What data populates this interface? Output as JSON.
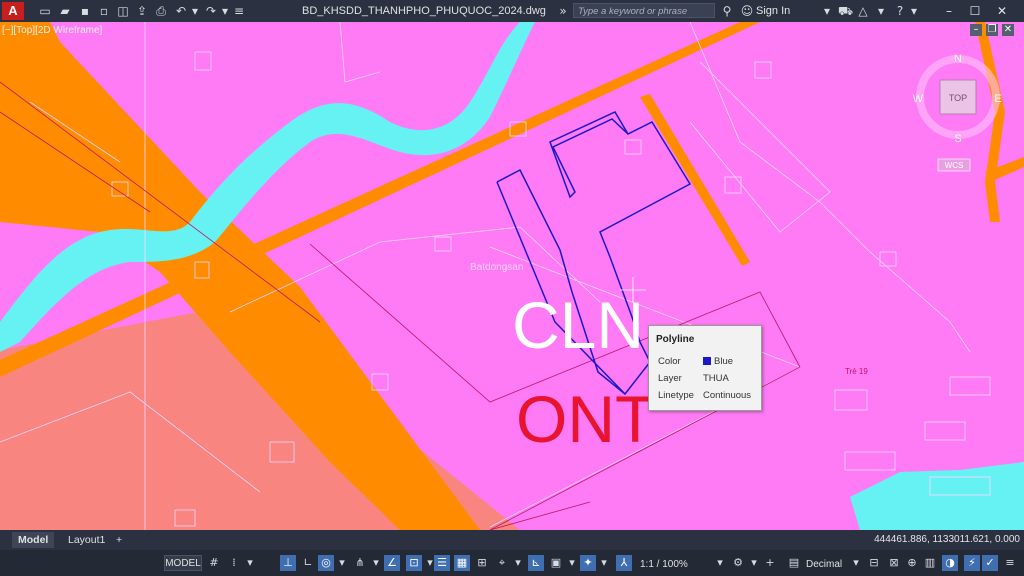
{
  "titlebar": {
    "app_logo": "A",
    "document_title": "BD_KHSDD_THANHPHO_PHUQUOC_2024.dwg",
    "search_placeholder": "Type a keyword or phrase",
    "sign_in": "Sign In",
    "icons": [
      "new-icon",
      "open-icon",
      "save-icon",
      "save-as-icon",
      "open-web-icon",
      "save-web-icon",
      "print-icon",
      "undo-icon",
      "redo-icon",
      "customize-icon",
      "search-icon",
      "binoculars-icon",
      "user-icon",
      "cart-icon",
      "share-icon",
      "help-icon",
      "minimize-icon",
      "maximize-icon",
      "close-icon"
    ]
  },
  "viewport": {
    "label": "[−][Top][2D Wireframe]",
    "viewcube": {
      "top": "TOP",
      "north": "N",
      "south": "S",
      "east": "E",
      "west": "W",
      "wcs": "WCS"
    },
    "zone_labels": {
      "primary": "CLN",
      "secondary": "ONT",
      "small": "Trẻ  19"
    },
    "watermark": "Batdongsan",
    "colors": {
      "land_pink": "#ff7bf5",
      "road_orange": "#ff8c00",
      "water_cyan": "#66f2f2",
      "salmon": "#f8857f",
      "polyline_blue": "#1a1ac8"
    }
  },
  "tooltip": {
    "title": "Polyline",
    "rows": [
      {
        "key": "Color",
        "value": "Blue"
      },
      {
        "key": "Layer",
        "value": "THUA"
      },
      {
        "key": "Linetype",
        "value": "Continuous"
      }
    ]
  },
  "tabs": [
    {
      "label": "Model",
      "active": true
    },
    {
      "label": "Layout1",
      "active": false
    }
  ],
  "add_tab": "+",
  "coordinates": "444461.886, 1133011.621, 0.000",
  "statusbar": {
    "model_label": "MODEL",
    "annotation_scale": "1:1 / 100%",
    "units": "Decimal"
  }
}
